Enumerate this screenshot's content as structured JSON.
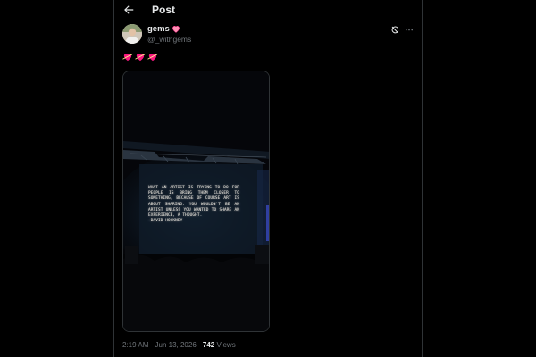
{
  "header": {
    "title": "Post",
    "back_icon": "arrow-left-icon"
  },
  "tweet": {
    "author": {
      "display_name": "gems",
      "handle": "@_withgems",
      "name_badge_icon": "pink-heart-icon"
    },
    "action_icons": [
      "grok-icon",
      "more-options-icon"
    ],
    "text_emojis": [
      "heart-with-arrow-icon",
      "heart-with-arrow-icon",
      "heart-with-arrow-icon"
    ],
    "media": {
      "kind": "photo",
      "screen_quote": "WHAT AN ARTIST IS TRYING TO DO FOR PEOPLE IS BRING THEM CLOSER TO SOMETHING, BECAUSE OF COURSE ART IS ABOUT SHARING. YOU WOULDN'T BE AN ARTIST UNLESS YOU WANTED TO SHARE AN EXPERIENCE, A THOUGHT.\n—DAVID HOCKNEY"
    },
    "meta": {
      "time": "2:19 AM",
      "separator": "·",
      "date": "Jun 13, 2026",
      "views_count": "742",
      "views_label": "Views"
    }
  },
  "colors": {
    "background": "#000000",
    "border": "#2f3336",
    "primary_text": "#e7e9ea",
    "secondary_text": "#71767b",
    "heart_pink": "#f91880"
  }
}
